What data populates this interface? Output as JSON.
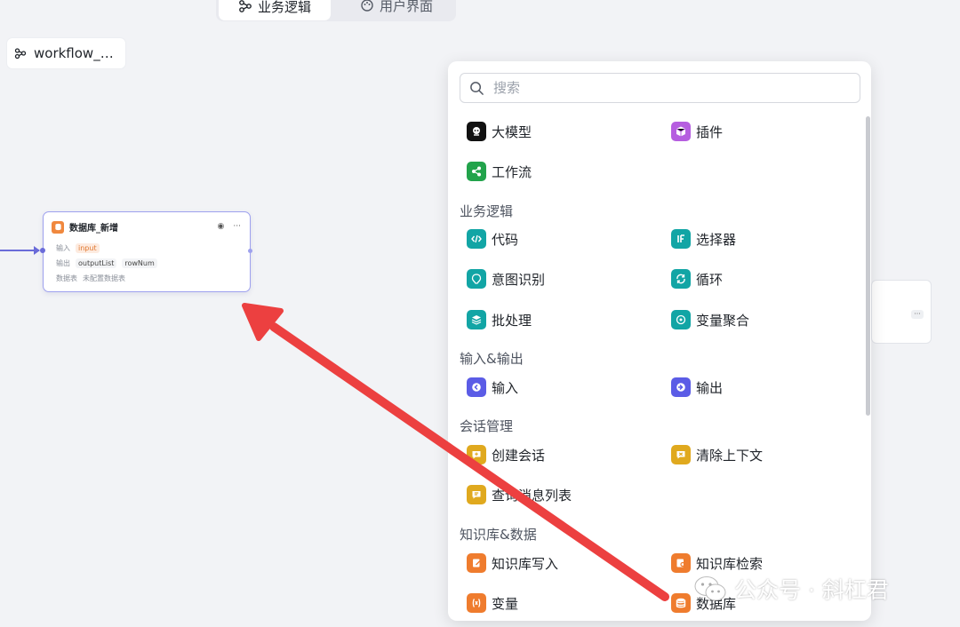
{
  "tabs": {
    "business_logic": "业务逻辑",
    "user_interface": "用户界面"
  },
  "workflow_chip": {
    "label": "workflow_…"
  },
  "node": {
    "title": "数据库_新增",
    "input_label": "输入",
    "input_value": "input",
    "output_label": "输出",
    "output_values": [
      "outputList",
      "rowNum"
    ],
    "db_label": "数据表",
    "db_value": "未配置数据表"
  },
  "panel": {
    "search_placeholder": "搜索",
    "top_items": [
      {
        "label": "大模型",
        "icon": "llm-icon",
        "color": "#111111"
      },
      {
        "label": "插件",
        "icon": "plugin-icon",
        "color": "#b65ee0"
      },
      {
        "label": "工作流",
        "icon": "workflow-icon",
        "color": "#22a34b"
      }
    ],
    "sections": [
      {
        "title": "业务逻辑",
        "items": [
          {
            "label": "代码",
            "icon": "code-icon",
            "color": "#12a5a5"
          },
          {
            "label": "选择器",
            "icon": "if-icon",
            "color": "#12a5a5"
          },
          {
            "label": "意图识别",
            "icon": "intent-icon",
            "color": "#12a5a5"
          },
          {
            "label": "循环",
            "icon": "loop-icon",
            "color": "#12a5a5"
          },
          {
            "label": "批处理",
            "icon": "batch-icon",
            "color": "#12a5a5"
          },
          {
            "label": "变量聚合",
            "icon": "aggregate-icon",
            "color": "#12a5a5"
          }
        ]
      },
      {
        "title": "输入&输出",
        "items": [
          {
            "label": "输入",
            "icon": "input-icon",
            "color": "#5b5ce6"
          },
          {
            "label": "输出",
            "icon": "output-icon",
            "color": "#5b5ce6"
          }
        ]
      },
      {
        "title": "会话管理",
        "items": [
          {
            "label": "创建会话",
            "icon": "chat-create-icon",
            "color": "#e0a91e"
          },
          {
            "label": "清除上下文",
            "icon": "chat-clear-icon",
            "color": "#e0a91e"
          },
          {
            "label": "查询消息列表",
            "icon": "chat-query-icon",
            "color": "#e0a91e"
          }
        ]
      },
      {
        "title": "知识库&数据",
        "items": [
          {
            "label": "知识库写入",
            "icon": "kb-write-icon",
            "color": "#ef7c2e"
          },
          {
            "label": "知识库检索",
            "icon": "kb-search-icon",
            "color": "#ef7c2e"
          },
          {
            "label": "变量",
            "icon": "variable-icon",
            "color": "#ef7c2e"
          },
          {
            "label": "数据库",
            "icon": "database-icon",
            "color": "#ef7c2e"
          }
        ]
      }
    ]
  },
  "watermark": {
    "text": "公众号 · 斜杠君"
  },
  "colors": {
    "accent": "#6a6bd9",
    "arrow": "#ec4040"
  }
}
